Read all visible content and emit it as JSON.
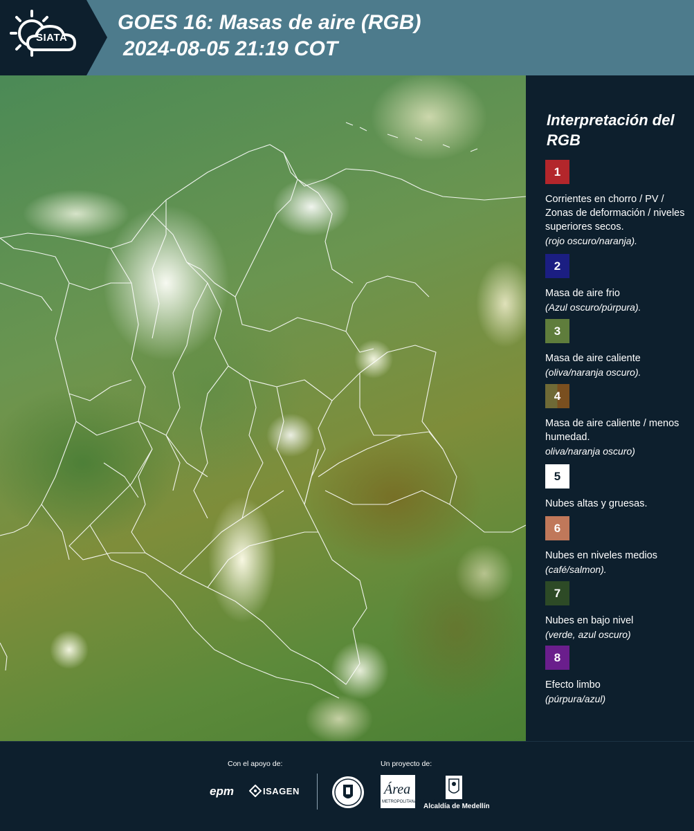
{
  "header": {
    "logo_text": "SIATA",
    "title_line1": "GOES 16: Masas de aire (RGB)",
    "title_line2": "2024-08-05 21:19 COT"
  },
  "legend": {
    "title": "Interpretación del RGB",
    "items": [
      {
        "number": "1",
        "color": "#b3262b",
        "description": "Corrientes en chorro / PV / Zonas de deformación / niveles superiores secos.",
        "note": "(rojo oscuro/naranja)."
      },
      {
        "number": "2",
        "color": "#1b1e82",
        "description": "Masa de aire frio",
        "note": "(Azul oscuro/púrpura)."
      },
      {
        "number": "3",
        "color": "#5f7d3c",
        "description": "Masa de aire caliente",
        "note": "(oliva/naranja oscuro)."
      },
      {
        "number": "4",
        "color": "#6e5a2a",
        "description": "Masa de aire caliente / menos humedad.",
        "note": "oliva/naranja oscuro)"
      },
      {
        "number": "5",
        "color": "#ffffff",
        "description": "Nubes altas y gruesas.",
        "note": ""
      },
      {
        "number": "6",
        "color": "#c0785a",
        "description": "Nubes en niveles medios",
        "note": "(café/salmon)."
      },
      {
        "number": "7",
        "color": "#2d4a26",
        "description": "Nubes en bajo nivel",
        "note": "(verde, azul oscuro)"
      },
      {
        "number": "8",
        "color": "#6a1e8c",
        "description": "Efecto limbo",
        "note": "(púrpura/azul)"
      }
    ]
  },
  "footer": {
    "support_label": "Con el apoyo de:",
    "project_label": "Un proyecto de:",
    "epm": "epm",
    "isagen": "ISAGEN",
    "area_logo": "Área",
    "area_subtitle": "METROPOLITANA Valle de Aburrá",
    "alcaldia": "Alcaldía de Medellín"
  }
}
